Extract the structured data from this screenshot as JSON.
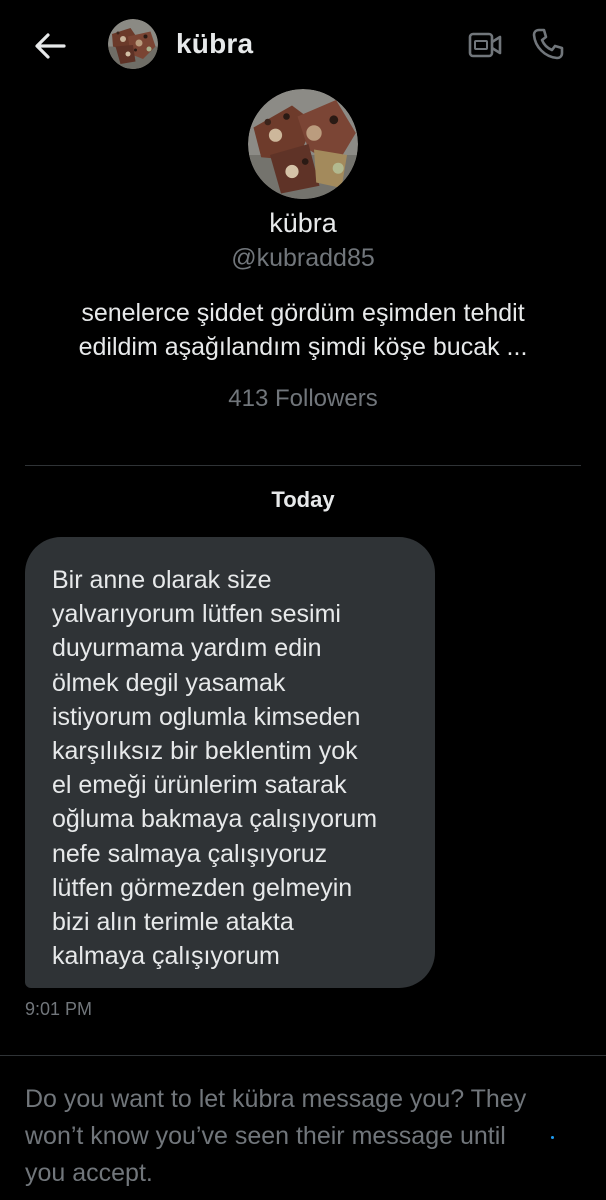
{
  "header": {
    "name": "kübra",
    "back_icon": "arrow-left-icon",
    "video_icon": "video-camera-icon",
    "call_icon": "phone-icon"
  },
  "profile": {
    "name": "kübra",
    "handle": "@kubradd85",
    "bio": "senelerce şiddet gördüm eşimden tehdit\nedildim aşağılandım şimdi köşe bucak ...",
    "followers": "413 Followers"
  },
  "conversation": {
    "date_label": "Today",
    "messages": [
      {
        "text": "Bir anne olarak size\nyalvarıyorum lütfen sesimi\nduyurmama yardım edin\nölmek degil yasamak\nistiyorum oglumla kimseden\nkarşılıksız bir beklentim yok\nel emeği ürünlerim satarak\noğluma bakmaya çalışıyorum\nnefe salmaya çalışıyoruz\nlütfen görmezden gelmeyin\nbizi alın terimle atakta\nkalmaya çalışıyorum",
        "time": "9:01 PM"
      }
    ]
  },
  "request": {
    "prompt": "Do you want to let kübra message you? They\nwon’t know you’ve seen their message until\nyou accept."
  },
  "colors": {
    "background": "#000000",
    "text_primary": "#e7e9ea",
    "text_secondary": "#71767b",
    "bubble": "#2f3336",
    "divider": "#2f3336",
    "accent": "#1d9bf0"
  }
}
